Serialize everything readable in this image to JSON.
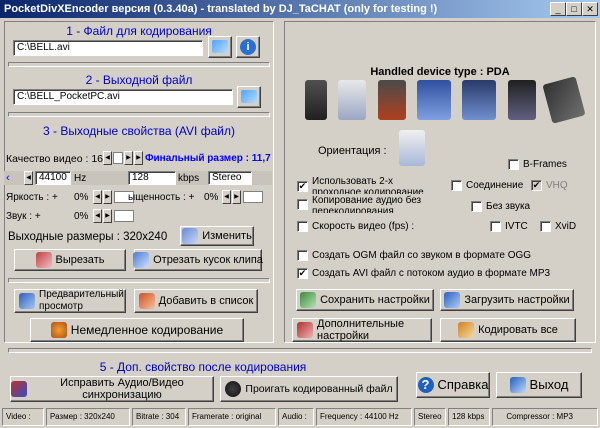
{
  "window": {
    "title": "PocketDivXEncoder версия (0.3.40a) - translated by DJ_TaCHAT (only for testing !)"
  },
  "section1": {
    "title": "1 - Файл для кодирования",
    "input_value": "C:\\BELL.avi"
  },
  "section2": {
    "title": "2 - Выходной файл",
    "output_value": "C:\\BELL_PocketPC.avi"
  },
  "section3": {
    "title": "3 - Выходные свойства (AVI файл)",
    "quality_label": "Качество видео : 16",
    "final_size": "Финальный размер : 11,7",
    "audio_freq": "44100",
    "hz": "Hz",
    "bitrate": "128",
    "kbps": "kbps",
    "channels": "Stereo",
    "brightness_label": "Яркость : +",
    "brightness_value": "0%",
    "saturation_label": "ыщенность : +",
    "saturation_value": "0%",
    "sound_label": "Звук : +",
    "sound_value": "0%",
    "output_size": "Выходные размеры : 320x240",
    "change_button": "Изменить",
    "cut_button": "Вырезать",
    "clip_button": "Отрезать кусок клипа"
  },
  "actions": {
    "preview": "Предварительный просмотр",
    "add_list": "Добавить в список",
    "encode_now": "Немедленное кодирование"
  },
  "device": {
    "title": "Handled device type : PDA",
    "orientation": "Ориентация :"
  },
  "options": {
    "bframes": "B-Frames",
    "twopass": "Использовать 2-х проходное кодирование",
    "connection": "Соединение",
    "vhq": "VHQ",
    "copy_audio": "Копирование аудио без перекодирования",
    "no_sound": "Без звука",
    "speed": "Скорость видео (fps) :",
    "ivtc": "IVTC",
    "xvid": "XviD",
    "ogg": "Создать OGM файл со звуком в формате OGG",
    "mp3": "Создать AVI файл с потоком аудио в формате MP3"
  },
  "settings": {
    "save": "Сохранить настройки",
    "load": "Загрузить настройки",
    "extra": "Дополнительные настройки",
    "encode_all": "Кодировать все"
  },
  "section5": {
    "title": "5 - Доп. свойство после кодирования",
    "fix_av": "Исправить Аудио/Видео синхронизацию",
    "play": "Проигать кодированный файл"
  },
  "footer": {
    "help": "Справка",
    "exit": "Выход"
  },
  "status": {
    "video": "Video :",
    "size": "Размер : 320x240",
    "bitrate": "Bitrate : 304",
    "framerate": "Framerate : original",
    "audio": "Audio :",
    "frequency": "Frequency : 44100 Hz",
    "stereo": "Stereo",
    "kbps": "128 kbps",
    "compressor": "Compressor : MP3"
  },
  "colors": {
    "title_start": "#0a246a",
    "title_end": "#a6caf0",
    "section_text": "#0000c0",
    "final_size": "#0000ff"
  }
}
